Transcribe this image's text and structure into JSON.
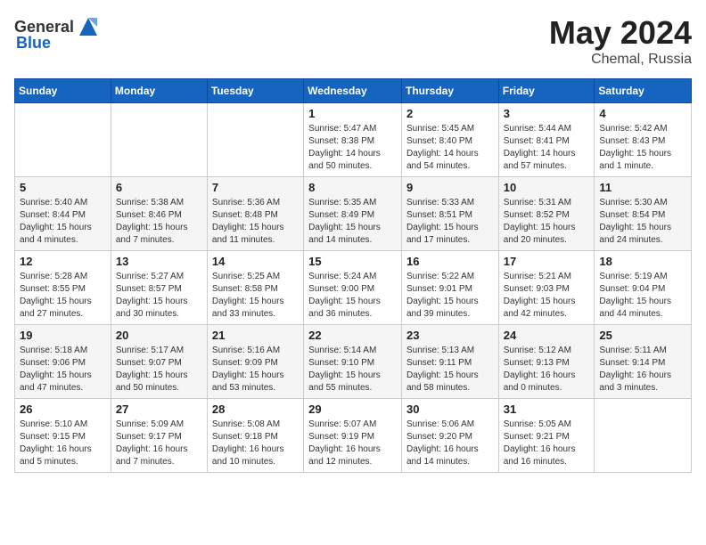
{
  "header": {
    "logo_general": "General",
    "logo_blue": "Blue",
    "month": "May 2024",
    "location": "Chemal, Russia"
  },
  "weekdays": [
    "Sunday",
    "Monday",
    "Tuesday",
    "Wednesday",
    "Thursday",
    "Friday",
    "Saturday"
  ],
  "weeks": [
    [
      {
        "day": "",
        "info": ""
      },
      {
        "day": "",
        "info": ""
      },
      {
        "day": "",
        "info": ""
      },
      {
        "day": "1",
        "info": "Sunrise: 5:47 AM\nSunset: 8:38 PM\nDaylight: 14 hours\nand 50 minutes."
      },
      {
        "day": "2",
        "info": "Sunrise: 5:45 AM\nSunset: 8:40 PM\nDaylight: 14 hours\nand 54 minutes."
      },
      {
        "day": "3",
        "info": "Sunrise: 5:44 AM\nSunset: 8:41 PM\nDaylight: 14 hours\nand 57 minutes."
      },
      {
        "day": "4",
        "info": "Sunrise: 5:42 AM\nSunset: 8:43 PM\nDaylight: 15 hours\nand 1 minute."
      }
    ],
    [
      {
        "day": "5",
        "info": "Sunrise: 5:40 AM\nSunset: 8:44 PM\nDaylight: 15 hours\nand 4 minutes."
      },
      {
        "day": "6",
        "info": "Sunrise: 5:38 AM\nSunset: 8:46 PM\nDaylight: 15 hours\nand 7 minutes."
      },
      {
        "day": "7",
        "info": "Sunrise: 5:36 AM\nSunset: 8:48 PM\nDaylight: 15 hours\nand 11 minutes."
      },
      {
        "day": "8",
        "info": "Sunrise: 5:35 AM\nSunset: 8:49 PM\nDaylight: 15 hours\nand 14 minutes."
      },
      {
        "day": "9",
        "info": "Sunrise: 5:33 AM\nSunset: 8:51 PM\nDaylight: 15 hours\nand 17 minutes."
      },
      {
        "day": "10",
        "info": "Sunrise: 5:31 AM\nSunset: 8:52 PM\nDaylight: 15 hours\nand 20 minutes."
      },
      {
        "day": "11",
        "info": "Sunrise: 5:30 AM\nSunset: 8:54 PM\nDaylight: 15 hours\nand 24 minutes."
      }
    ],
    [
      {
        "day": "12",
        "info": "Sunrise: 5:28 AM\nSunset: 8:55 PM\nDaylight: 15 hours\nand 27 minutes."
      },
      {
        "day": "13",
        "info": "Sunrise: 5:27 AM\nSunset: 8:57 PM\nDaylight: 15 hours\nand 30 minutes."
      },
      {
        "day": "14",
        "info": "Sunrise: 5:25 AM\nSunset: 8:58 PM\nDaylight: 15 hours\nand 33 minutes."
      },
      {
        "day": "15",
        "info": "Sunrise: 5:24 AM\nSunset: 9:00 PM\nDaylight: 15 hours\nand 36 minutes."
      },
      {
        "day": "16",
        "info": "Sunrise: 5:22 AM\nSunset: 9:01 PM\nDaylight: 15 hours\nand 39 minutes."
      },
      {
        "day": "17",
        "info": "Sunrise: 5:21 AM\nSunset: 9:03 PM\nDaylight: 15 hours\nand 42 minutes."
      },
      {
        "day": "18",
        "info": "Sunrise: 5:19 AM\nSunset: 9:04 PM\nDaylight: 15 hours\nand 44 minutes."
      }
    ],
    [
      {
        "day": "19",
        "info": "Sunrise: 5:18 AM\nSunset: 9:06 PM\nDaylight: 15 hours\nand 47 minutes."
      },
      {
        "day": "20",
        "info": "Sunrise: 5:17 AM\nSunset: 9:07 PM\nDaylight: 15 hours\nand 50 minutes."
      },
      {
        "day": "21",
        "info": "Sunrise: 5:16 AM\nSunset: 9:09 PM\nDaylight: 15 hours\nand 53 minutes."
      },
      {
        "day": "22",
        "info": "Sunrise: 5:14 AM\nSunset: 9:10 PM\nDaylight: 15 hours\nand 55 minutes."
      },
      {
        "day": "23",
        "info": "Sunrise: 5:13 AM\nSunset: 9:11 PM\nDaylight: 15 hours\nand 58 minutes."
      },
      {
        "day": "24",
        "info": "Sunrise: 5:12 AM\nSunset: 9:13 PM\nDaylight: 16 hours\nand 0 minutes."
      },
      {
        "day": "25",
        "info": "Sunrise: 5:11 AM\nSunset: 9:14 PM\nDaylight: 16 hours\nand 3 minutes."
      }
    ],
    [
      {
        "day": "26",
        "info": "Sunrise: 5:10 AM\nSunset: 9:15 PM\nDaylight: 16 hours\nand 5 minutes."
      },
      {
        "day": "27",
        "info": "Sunrise: 5:09 AM\nSunset: 9:17 PM\nDaylight: 16 hours\nand 7 minutes."
      },
      {
        "day": "28",
        "info": "Sunrise: 5:08 AM\nSunset: 9:18 PM\nDaylight: 16 hours\nand 10 minutes."
      },
      {
        "day": "29",
        "info": "Sunrise: 5:07 AM\nSunset: 9:19 PM\nDaylight: 16 hours\nand 12 minutes."
      },
      {
        "day": "30",
        "info": "Sunrise: 5:06 AM\nSunset: 9:20 PM\nDaylight: 16 hours\nand 14 minutes."
      },
      {
        "day": "31",
        "info": "Sunrise: 5:05 AM\nSunset: 9:21 PM\nDaylight: 16 hours\nand 16 minutes."
      },
      {
        "day": "",
        "info": ""
      }
    ]
  ]
}
